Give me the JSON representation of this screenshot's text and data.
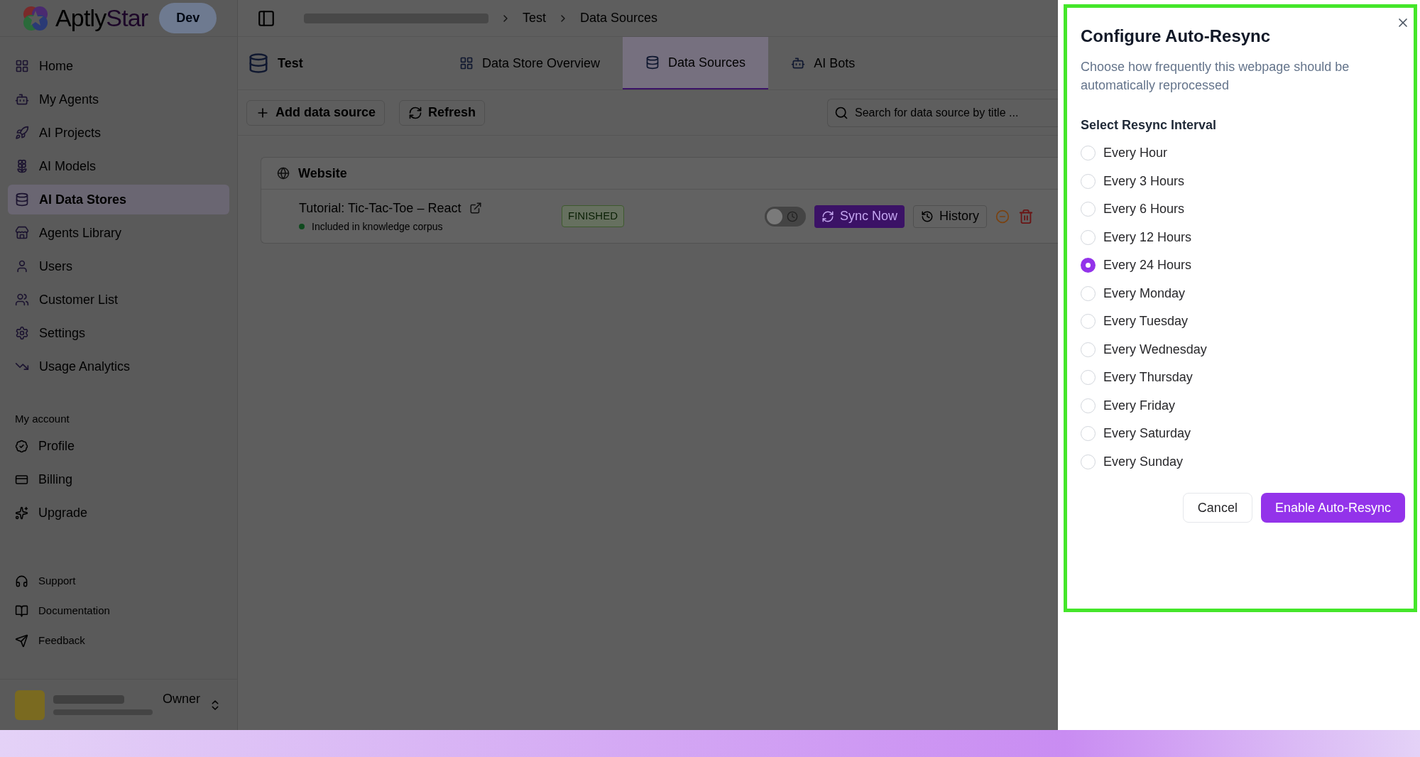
{
  "brand": {
    "name": "Aptly",
    "accent": "Star",
    "env": "Dev"
  },
  "breadcrumb": [
    "Test",
    "Data Sources"
  ],
  "sidebar": {
    "items": [
      {
        "label": "Home",
        "selected": false
      },
      {
        "label": "My Agents",
        "selected": false
      },
      {
        "label": "AI Projects",
        "selected": false
      },
      {
        "label": "AI Models",
        "selected": false
      },
      {
        "label": "AI Data Stores",
        "selected": true
      },
      {
        "label": "Agents Library",
        "selected": false
      },
      {
        "label": "Users",
        "selected": false
      },
      {
        "label": "Customer List",
        "selected": false
      },
      {
        "label": "Settings",
        "selected": false
      },
      {
        "label": "Usage Analytics",
        "selected": false
      }
    ],
    "account_heading": "My account",
    "account_items": [
      "Profile",
      "Billing",
      "Upgrade"
    ],
    "footer_items": [
      "Support",
      "Documentation",
      "Feedback"
    ],
    "user": {
      "role": "Owner"
    }
  },
  "data_store": {
    "name": "Test",
    "tabs": [
      {
        "label": "Data Store Overview",
        "selected": false
      },
      {
        "label": "Data Sources",
        "selected": true
      },
      {
        "label": "AI Bots",
        "selected": false
      }
    ],
    "toolbar": [
      "Add data source",
      "Refresh"
    ],
    "search": {
      "placeholder": "Search for data source by title ..."
    },
    "section": "Website",
    "sources": [
      {
        "title": "Tutorial: Tic-Tac-Toe – React",
        "status": "Included in knowledge corpus",
        "badge": "FINISHED",
        "auto_resync": false,
        "actions": [
          "Sync Now",
          "History"
        ]
      }
    ]
  },
  "dialog": {
    "title": "Configure Auto-Resync",
    "description": "Choose how frequently this webpage should be automatically reprocessed",
    "label": "Select Resync Interval",
    "options": [
      {
        "label": "Every Hour",
        "selected": false
      },
      {
        "label": "Every 3 Hours",
        "selected": false
      },
      {
        "label": "Every 6 Hours",
        "selected": false
      },
      {
        "label": "Every 12 Hours",
        "selected": false
      },
      {
        "label": "Every 24 Hours",
        "selected": true
      },
      {
        "label": "Every Monday",
        "selected": false
      },
      {
        "label": "Every Tuesday",
        "selected": false
      },
      {
        "label": "Every Wednesday",
        "selected": false
      },
      {
        "label": "Every Thursday",
        "selected": false
      },
      {
        "label": "Every Friday",
        "selected": false
      },
      {
        "label": "Every Saturday",
        "selected": false
      },
      {
        "label": "Every Sunday",
        "selected": false
      }
    ],
    "buttons": [
      "Cancel",
      "Enable Auto-Resync"
    ]
  }
}
